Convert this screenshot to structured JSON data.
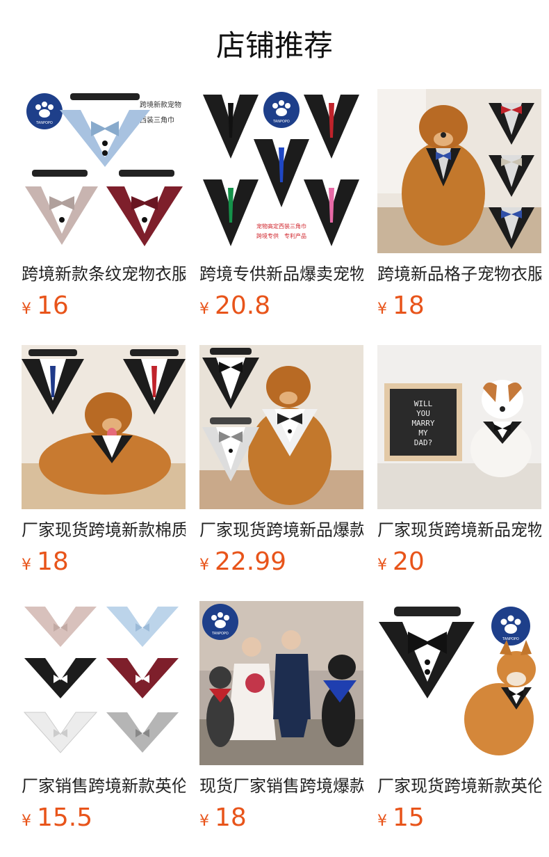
{
  "header": {
    "title": "店铺推荐"
  },
  "currency": "¥",
  "products": [
    {
      "name": "跨境新款条纹宠物衣服",
      "price": "16",
      "image_text": {
        "brand": "TANPOPO",
        "line1": "跨境新款宠物",
        "line2": "西装三角巾"
      }
    },
    {
      "name": "跨境专供新品爆卖宠物",
      "price": "20.8",
      "image_text": {
        "brand": "TANPOPO",
        "line1": "宠物高定西装三角巾",
        "line2": "跨境专供　专利产品"
      }
    },
    {
      "name": "跨境新品格子宠物衣服",
      "price": "18"
    },
    {
      "name": "厂家现货跨境新款棉质",
      "price": "18"
    },
    {
      "name": "厂家现货跨境新品爆款",
      "price": "22.99"
    },
    {
      "name": "厂家现货跨境新品宠物",
      "price": "20",
      "image_text": {
        "sign": [
          "WILL",
          "YOU",
          "MARRY",
          "MY",
          "DAD?"
        ]
      }
    },
    {
      "name": "厂家销售跨境新款英伦",
      "price": "15.5"
    },
    {
      "name": "现货厂家销售跨境爆款",
      "price": "18",
      "image_text": {
        "brand": "TANPOPO"
      }
    },
    {
      "name": "厂家现货跨境新款英伦",
      "price": "15",
      "image_text": {
        "brand": "TANPOPO"
      }
    }
  ],
  "colors": {
    "price": "#e8541a",
    "title": "#111111"
  }
}
